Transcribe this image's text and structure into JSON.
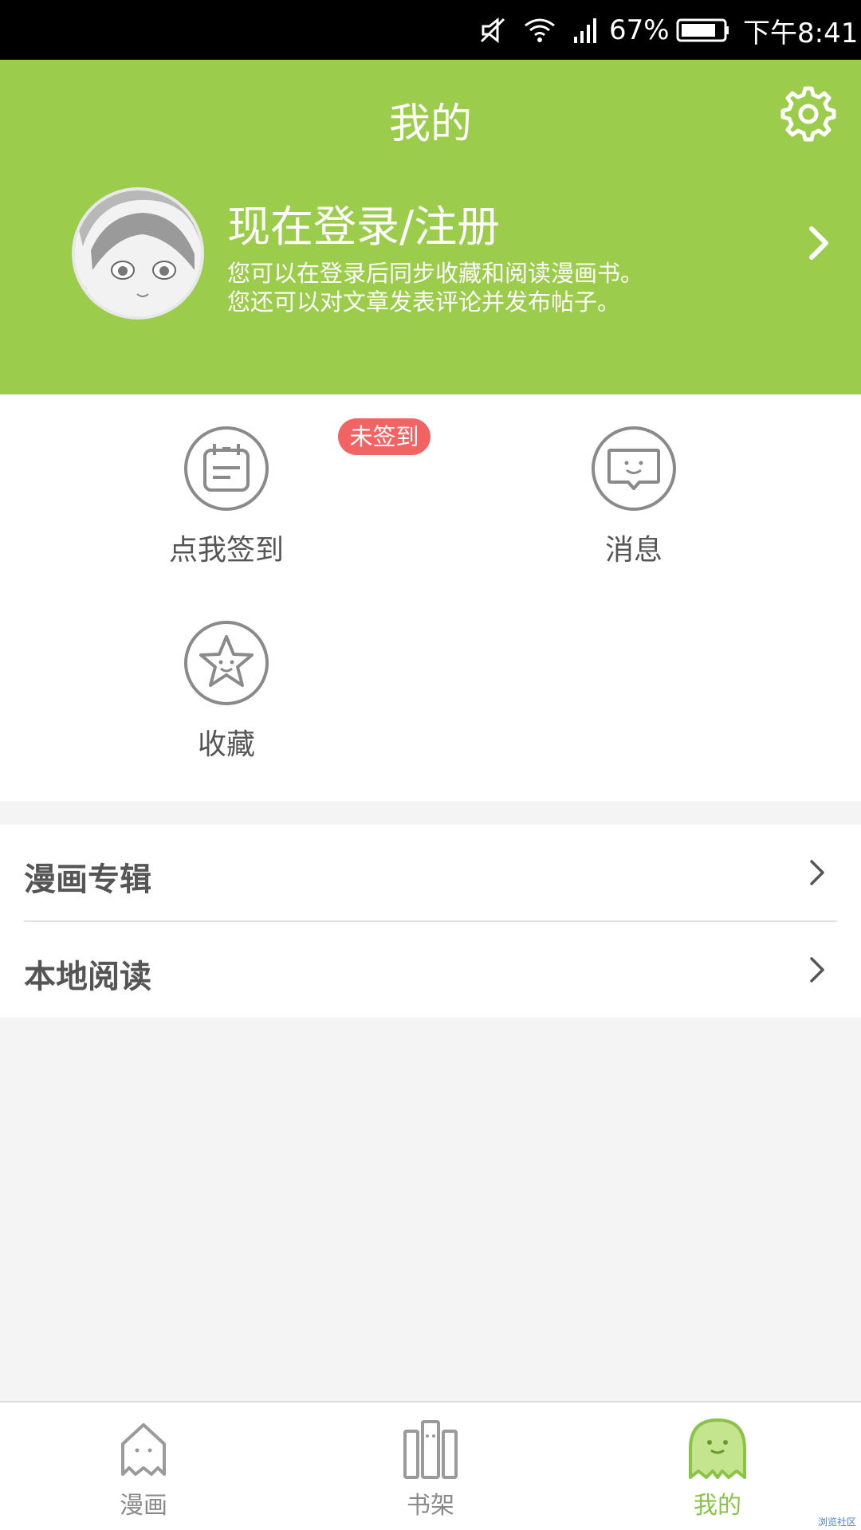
{
  "status_bar": {
    "battery_percent": "67%",
    "time": "下午8:41"
  },
  "header": {
    "title": "我的",
    "login_title": "现在登录/注册",
    "login_desc_line1": "您可以在登录后同步收藏和阅读漫画书。",
    "login_desc_line2": "您还可以对文章发表评论并发布帖子。",
    "background_color": "#9ccc4c"
  },
  "grid": {
    "checkin_label": "点我签到",
    "checkin_badge": "未签到",
    "messages_label": "消息",
    "favorites_label": "收藏"
  },
  "list": {
    "items": [
      {
        "label": "漫画专辑"
      },
      {
        "label": "本地阅读"
      }
    ]
  },
  "tabbar": {
    "tabs": [
      {
        "label": "漫画",
        "icon": "house-ghost-icon",
        "active": false
      },
      {
        "label": "书架",
        "icon": "bookshelf-icon",
        "active": false
      },
      {
        "label": "我的",
        "icon": "ghost-icon",
        "active": true
      }
    ],
    "active_color": "#8bc34a"
  },
  "watermark": "浏览社区"
}
